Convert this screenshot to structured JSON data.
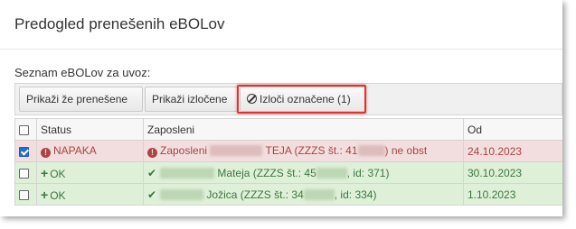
{
  "title": "Predogled prenešenih eBOLov",
  "list_label": "Seznam eBOLov za uvoz:",
  "toolbar": {
    "show_transferred": "Prikaži že prenešene",
    "show_excluded": "Prikaži izločene",
    "exclude_selected": "Izloči označene (1)"
  },
  "table": {
    "headers": [
      "Status",
      "Zaposleni",
      "Od"
    ],
    "rows": [
      {
        "checked": true,
        "status": "NAPAKA",
        "employee_prefix": "Zaposleni",
        "employee_name": "TEJA (ZZZS št.: 41",
        "employee_suffix": ") ne obst",
        "from": "24.10.2023"
      },
      {
        "checked": false,
        "status": "OK",
        "employee_name": "Mateja (ZZZS št.: 45",
        "employee_suffix": ", id: 371)",
        "from": "30.10.2023"
      },
      {
        "checked": false,
        "status": "OK",
        "employee_name": "Jožica (ZZZS št.: 34",
        "employee_suffix": ", id: 334)",
        "from": "1.10.2023"
      }
    ]
  },
  "colors": {
    "error_bg": "#f2dede",
    "error_text": "#a94442",
    "ok_bg": "#dff0d8",
    "ok_text": "#3c763d",
    "highlight": "#e0322f"
  },
  "icons": {
    "exclude": "ban-icon",
    "error": "exclamation-circle-icon",
    "ok": "plus-icon",
    "valid": "check-icon"
  }
}
